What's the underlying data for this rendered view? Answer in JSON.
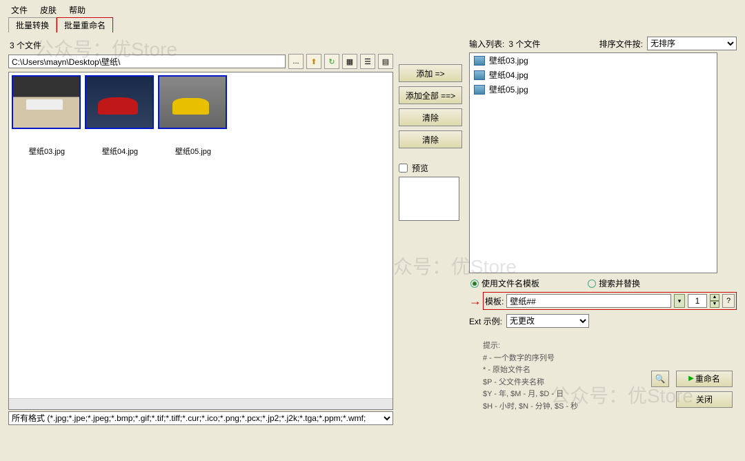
{
  "menu": {
    "file": "文件",
    "skin": "皮肤",
    "help": "帮助"
  },
  "tabs": {
    "convert": "批量转换",
    "rename": "批量重命名"
  },
  "watermark": "公众号：优Store",
  "left": {
    "count": "3 个文件",
    "path": "C:\\Users\\mayn\\Desktop\\壁纸\\",
    "browse": "...",
    "thumbs": [
      {
        "name": "壁纸03.jpg"
      },
      {
        "name": "壁纸04.jpg"
      },
      {
        "name": "壁纸05.jpg"
      }
    ],
    "formats": "所有格式 (*.jpg;*.jpe;*.jpeg;*.bmp;*.gif;*.tif;*.tiff;*.cur;*.ico;*.png;*.pcx;*.jp2;*.j2k;*.tga;*.ppm;*.wmf;"
  },
  "mid": {
    "add": "添加 =>",
    "addall": "添加全部 ==>",
    "clear1": "清除",
    "clear2": "清除",
    "preview": "预览"
  },
  "right": {
    "inputlist": "输入列表:",
    "inputcount": "3 个文件",
    "sortlabel": "排序文件按:",
    "sortvalue": "无排序",
    "items": [
      {
        "name": "壁纸03.jpg"
      },
      {
        "name": "壁纸04.jpg"
      },
      {
        "name": "壁纸05.jpg"
      }
    ],
    "radio_template": "使用文件名模板",
    "radio_replace": "搜索并替换",
    "tpl_label": "模板:",
    "tpl_value": "壁纸##",
    "tpl_start": "1",
    "tpl_help": "?",
    "ext_label": "Ext 示例:",
    "ext_value": "无更改",
    "hints_label": "提示:",
    "hints": [
      "# - 一个数字的序列号",
      "* - 原始文件名",
      "$P - 父文件夹名称",
      "$Y - 年,    $M - 月,    $D - 日",
      "$H - 小时,    $N - 分钟,    $S - 秒"
    ],
    "search_btn": "🔍",
    "rename_btn": "重命名",
    "close_btn": "关闭"
  }
}
